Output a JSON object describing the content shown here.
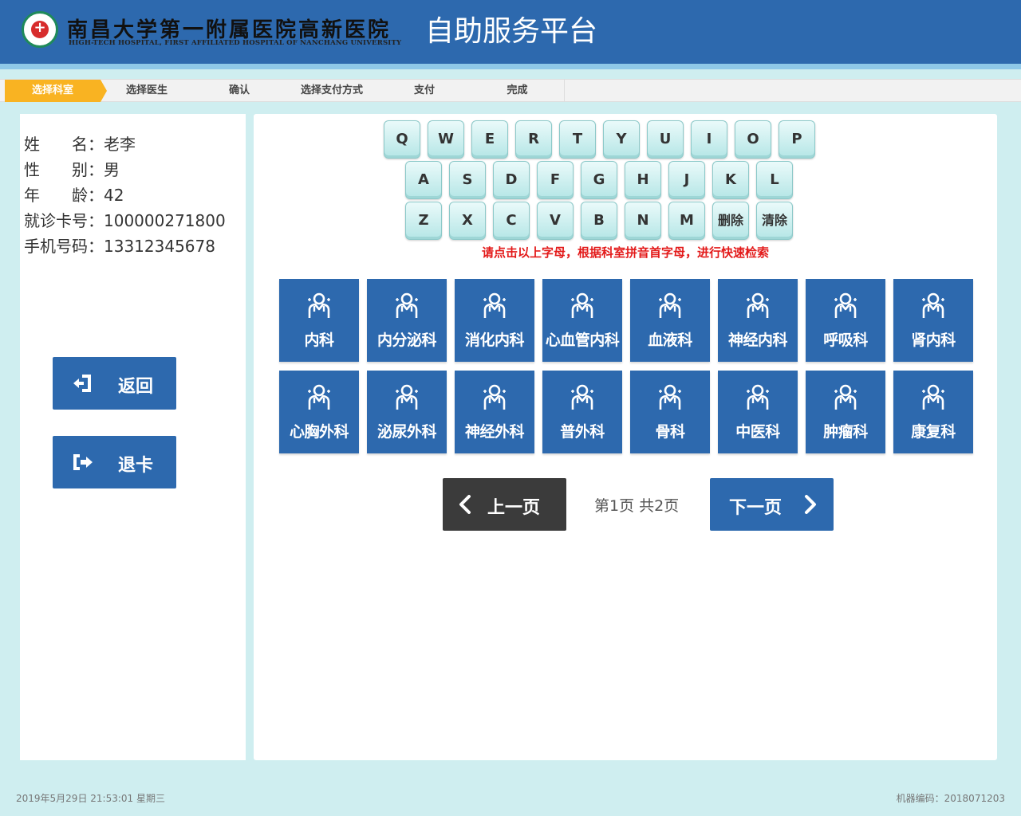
{
  "header": {
    "hospital_name": "南昌大学第一附属医院高新医院",
    "hospital_name_en": "HIGH-TECH HOSPITAL, FIRST AFFILIATED HOSPITAL OF NANCHANG UNIVERSITY",
    "platform_title": "自助服务平台",
    "logo_icon": "hospital-logo"
  },
  "steps": [
    {
      "label": "选择科室",
      "active": true
    },
    {
      "label": "选择医生",
      "active": false
    },
    {
      "label": "确认",
      "active": false
    },
    {
      "label": "选择支付方式",
      "active": false
    },
    {
      "label": "支付",
      "active": false
    },
    {
      "label": "完成",
      "active": false
    }
  ],
  "patient": {
    "name_label": "姓　　名：",
    "name": "老李",
    "gender_label": "性　　别：",
    "gender": "男",
    "age_label": "年　　龄：",
    "age": "42",
    "card_label": "就诊卡号：",
    "card": "100000271800",
    "phone_label": "手机号码：",
    "phone": "13312345678"
  },
  "side_buttons": {
    "back_label": "返回",
    "back_icon": "sign-in-icon",
    "eject_label": "退卡",
    "eject_icon": "sign-out-icon"
  },
  "keyboard": {
    "row1": [
      "Q",
      "W",
      "E",
      "R",
      "T",
      "Y",
      "U",
      "I",
      "O",
      "P"
    ],
    "row2": [
      "A",
      "S",
      "D",
      "F",
      "G",
      "H",
      "J",
      "K",
      "L"
    ],
    "row3": [
      "Z",
      "X",
      "C",
      "V",
      "B",
      "N",
      "M"
    ],
    "delete_label": "删除",
    "clear_label": "清除",
    "hint": "请点击以上字母，根据科室拼音首字母，进行快速检索"
  },
  "departments": [
    "内科",
    "内分泌科",
    "消化内科",
    "心血管内科",
    "血液科",
    "神经内科",
    "呼吸科",
    "肾内科",
    "心胸外科",
    "泌尿外科",
    "神经外科",
    "普外科",
    "骨科",
    "中医科",
    "肿瘤科",
    "康复科"
  ],
  "department_icon": "doctor-icon",
  "pager": {
    "prev_label": "上一页",
    "next_label": "下一页",
    "info": "第1页 共2页",
    "prev_color": "#3b3b3b",
    "next_color": "#2d69ae"
  },
  "footer": {
    "datetime": "2019年5月29日 21:53:01 星期三",
    "machine": "机器编码：2018071203"
  },
  "colors": {
    "primary": "#2d69ae",
    "active_step": "#f9b322",
    "background": "#cfeef0",
    "hint": "#e31a1a"
  }
}
